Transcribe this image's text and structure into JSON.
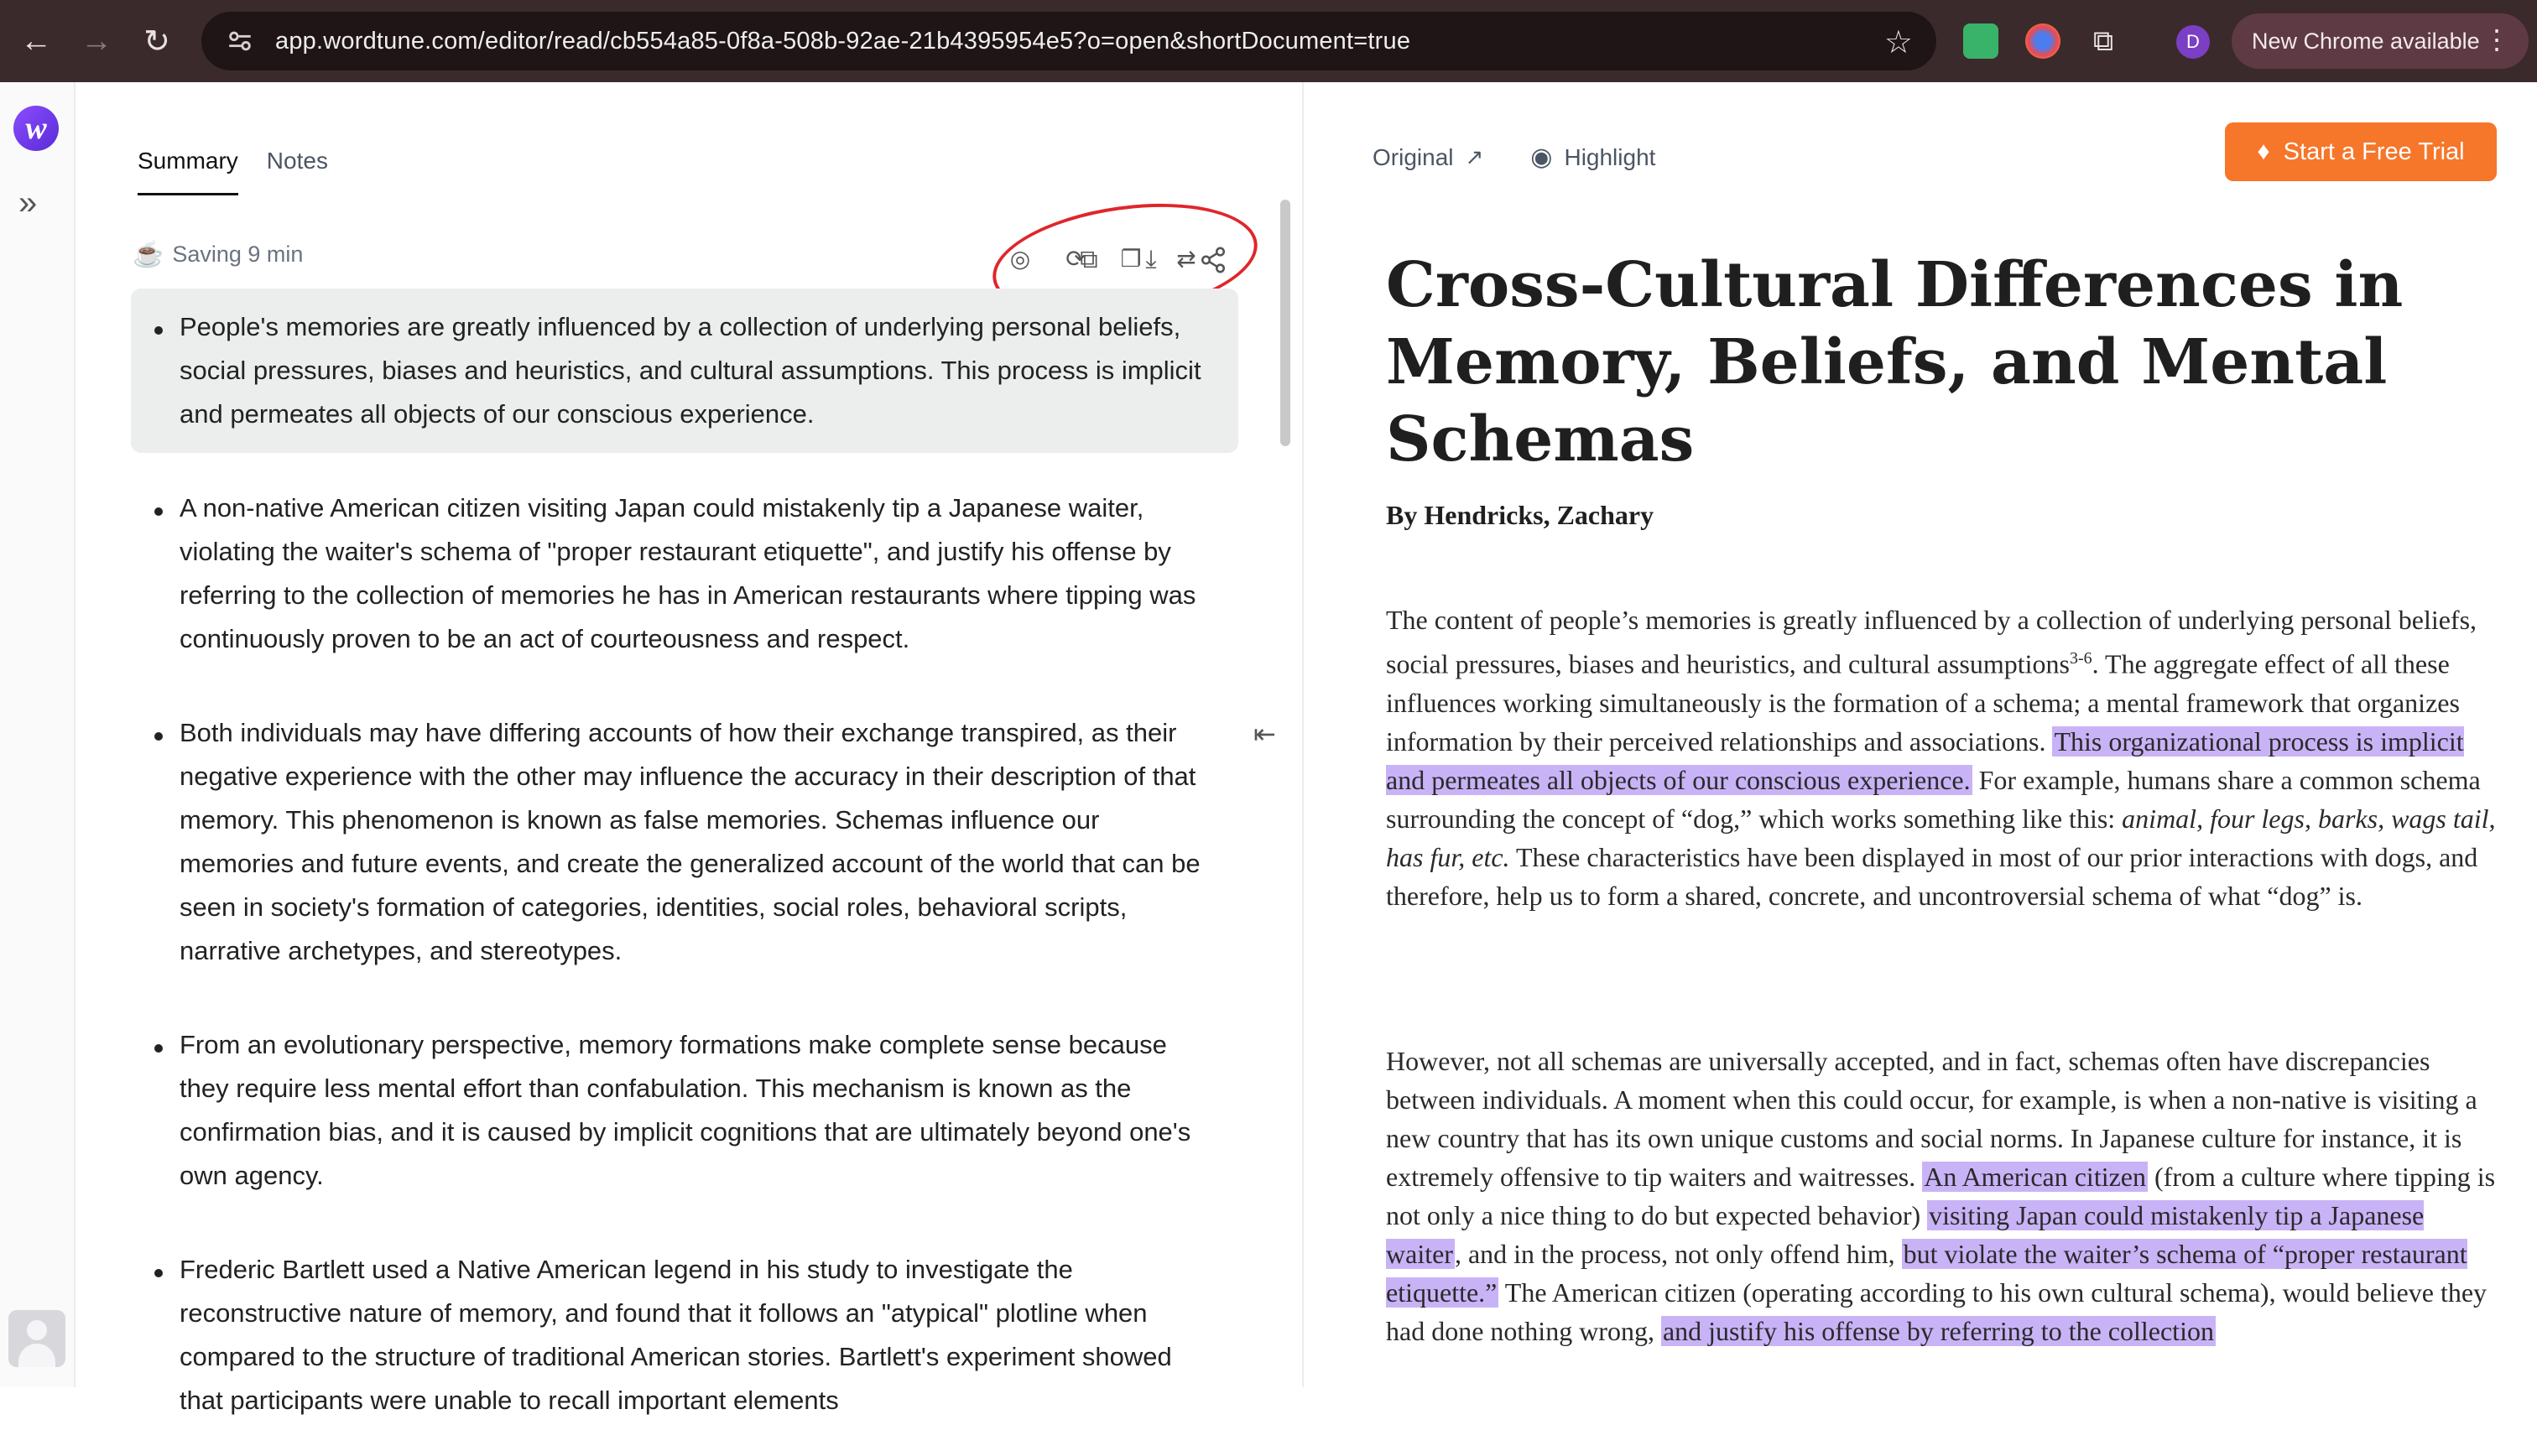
{
  "browser": {
    "url": "app.wordtune.com/editor/read/cb554a85-0f8a-508b-92ae-21b4395954e5?o=open&shortDocument=true",
    "profile_initial": "D",
    "update_label": "New Chrome available"
  },
  "summary_panel": {
    "tabs": [
      {
        "label": "Summary",
        "active": true
      },
      {
        "label": "Notes",
        "active": false
      }
    ],
    "saving_label": "Saving 9 min",
    "bullets": [
      "People's memories are greatly influenced by a collection of underlying personal beliefs, social pressures, biases and heuristics, and cultural assumptions. This process is implicit and permeates all objects of our conscious experience.",
      "A non-native American citizen visiting Japan could mistakenly tip a Japanese waiter, violating the waiter's schema of \"proper restaurant etiquette\", and justify his offense by referring to the collection of memories he has in American restaurants where tipping was continuously proven to be an act of courteousness and respect.",
      "Both individuals may have differing accounts of how their exchange transpired, as their negative experience with the other may influence the accuracy in their description of that memory. This phenomenon is known as false memories. Schemas influence our memories and future events, and create the generalized account of the world that can be seen in society's formation of categories, identities, social roles, behavioral scripts, narrative archetypes, and stereotypes.",
      "From an evolutionary perspective, memory formations make complete sense because they require less mental effort than confabulation. This mechanism is known as the confirmation bias, and it is caused by implicit cognitions that are ultimately beyond one's own agency.",
      "Frederic Bartlett used a Native American legend in his study to investigate the reconstructive nature of memory, and found that it follows an \"atypical\" plotline when compared to the structure of traditional American stories. Bartlett's experiment showed that participants were unable to recall important elements"
    ]
  },
  "original_panel": {
    "original_label": "Original",
    "highlight_label": "Highlight",
    "trial_label": "Start a Free Trial",
    "title": "Cross-Cultural Differences in Memory, Beliefs, and Mental Schemas",
    "byline": "By Hendricks, Zachary",
    "p1": {
      "a": "The content of people’s memories is greatly influenced by a collection of underlying personal beliefs, social pressures, biases and heuristics, and cultural assumptions",
      "sup": "3-6",
      "b": ". The aggregate effect of all these influences working simultaneously is the formation of a schema; a mental framework that organizes information by their perceived relationships and associations. ",
      "hl": "This organizational process is implicit and permeates all objects of our conscious experience.",
      "c": " For example, humans share a common schema surrounding the concept of “dog,” which works something like this: ",
      "em": "animal, four legs, barks, wags tail, has fur, etc.",
      "d": " These characteristics have been displayed in most of our prior interactions with dogs, and therefore, help us to form a shared, concrete, and uncontroversial schema of what “dog” is."
    },
    "p2": {
      "a": "However, not all schemas are universally accepted, and in fact, schemas often have discrepancies between individuals. A moment when this could occur, for example, is when a non-native is visiting a new country that has its own unique customs and social norms. In Japanese culture for instance, it is extremely offensive to tip waiters and waitresses. ",
      "hl1": "An American citizen",
      "b": " (from a culture where tipping is not only a nice thing to do but expected behavior) ",
      "hl2": "visiting Japan could mistakenly tip a Japanese waiter",
      "c": ", and in the process, not only offend him, ",
      "hl3": "but violate the waiter’s schema of “proper restaurant etiquette.”",
      "d": " The American citizen (operating according to his own cultural schema), would believe they had done nothing wrong, ",
      "hl4": "and justify his offense by referring to the collection"
    }
  },
  "colors": {
    "chrome_bg": "#3b2a2c",
    "trial_button": "#f6762a",
    "highlight": "#c9b3f7",
    "annotation": "#e0262b"
  }
}
